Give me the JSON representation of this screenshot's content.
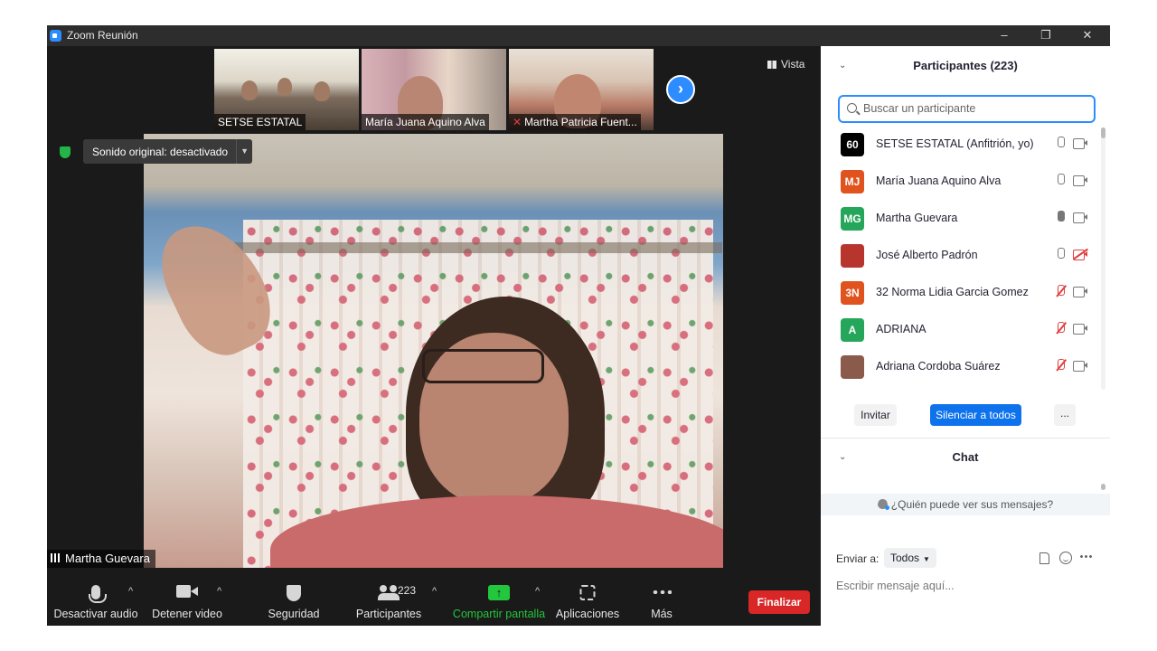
{
  "window": {
    "title": "Zoom Reunión",
    "minimize": "–",
    "restore": "❐",
    "close": "✕"
  },
  "thumbnails": [
    {
      "name": "SETSE ESTATAL",
      "muted": false
    },
    {
      "name": "María Juana Aquino Alva",
      "muted": false
    },
    {
      "name": "Martha Patricia Fuent...",
      "muted": true
    }
  ],
  "view_label": "Vista",
  "original_sound": "Sonido original: desactivado",
  "active_speaker": "Martha Guevara",
  "toolbar": {
    "audio": "Desactivar audio",
    "video": "Detener video",
    "security": "Seguridad",
    "participants": "Participantes",
    "participants_count": "223",
    "share": "Compartir pantalla",
    "apps": "Aplicaciones",
    "more": "Más",
    "end": "Finalizar"
  },
  "participants_panel": {
    "title": "Participantes (223)",
    "search_placeholder": "Buscar un participante",
    "items": [
      {
        "initials": "60",
        "name": "SETSE ESTATAL (Anfitrión, yo)",
        "avatar_color": "#000000",
        "mic": "on",
        "cam": "on"
      },
      {
        "initials": "MJ",
        "name": "María Juana Aquino Alva",
        "avatar_color": "#e0531f",
        "mic": "on",
        "cam": "on"
      },
      {
        "initials": "MG",
        "name": "Martha Guevara",
        "avatar_color": "#26a65b",
        "mic": "active",
        "cam": "on"
      },
      {
        "initials": "",
        "name": "José Alberto Padrón",
        "avatar_color": "#b8352e",
        "mic": "on",
        "cam": "off"
      },
      {
        "initials": "3N",
        "name": "32 Norma Lidia Garcia Gomez",
        "avatar_color": "#e0531f",
        "mic": "muted",
        "cam": "on"
      },
      {
        "initials": "A",
        "name": "ADRIANA",
        "avatar_color": "#26a65b",
        "mic": "muted",
        "cam": "on"
      },
      {
        "initials": "",
        "name": "Adriana Cordoba Suárez",
        "avatar_color": "#8a5a4a",
        "mic": "muted",
        "cam": "on"
      }
    ],
    "invite": "Invitar",
    "mute_all": "Silenciar a todos",
    "more": "..."
  },
  "chat_panel": {
    "title": "Chat",
    "who_can_see": "¿Quién puede ver sus mensajes?",
    "send_to_label": "Enviar a:",
    "send_to_value": "Todos",
    "input_placeholder": "Escribir mensaje aquí..."
  }
}
